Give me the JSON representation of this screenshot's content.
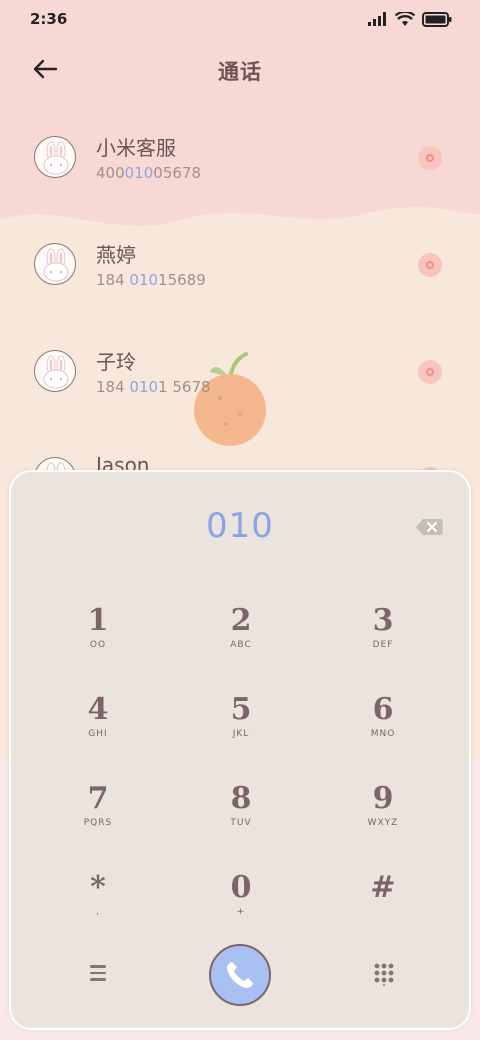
{
  "status": {
    "time": "2:36",
    "battery": "battery-icon",
    "wifi": "wifi-icon",
    "signal": "signal-icon"
  },
  "header": {
    "title": "通话",
    "back_icon": "back-arrow-icon"
  },
  "contacts": [
    {
      "name": "小米客服",
      "number_prefix": "400",
      "number_match": "010",
      "number_suffix": "05678"
    },
    {
      "name": "燕婷",
      "number_prefix": "184 ",
      "number_match": "010",
      "number_suffix": "15689"
    },
    {
      "name": "子玲",
      "number_prefix": "184 ",
      "number_match": "010",
      "number_suffix": "1 5678"
    },
    {
      "name": "Jason",
      "number_prefix": "",
      "number_match": "",
      "number_suffix": ""
    }
  ],
  "dialpad": {
    "input": "010",
    "keys": [
      {
        "digit": "1",
        "letters": "OO"
      },
      {
        "digit": "2",
        "letters": "ABC"
      },
      {
        "digit": "3",
        "letters": "DEF"
      },
      {
        "digit": "4",
        "letters": "GHI"
      },
      {
        "digit": "5",
        "letters": "JKL"
      },
      {
        "digit": "6",
        "letters": "MNO"
      },
      {
        "digit": "7",
        "letters": "PQRS"
      },
      {
        "digit": "8",
        "letters": "TUV"
      },
      {
        "digit": "9",
        "letters": "WXYZ"
      },
      {
        "digit": "*",
        "letters": ","
      },
      {
        "digit": "0",
        "letters": "+"
      },
      {
        "digit": "#",
        "letters": ""
      }
    ]
  },
  "colors": {
    "accent": "#8aa4e4",
    "call_button": "#a9c0f2",
    "text": "#6b5453"
  }
}
